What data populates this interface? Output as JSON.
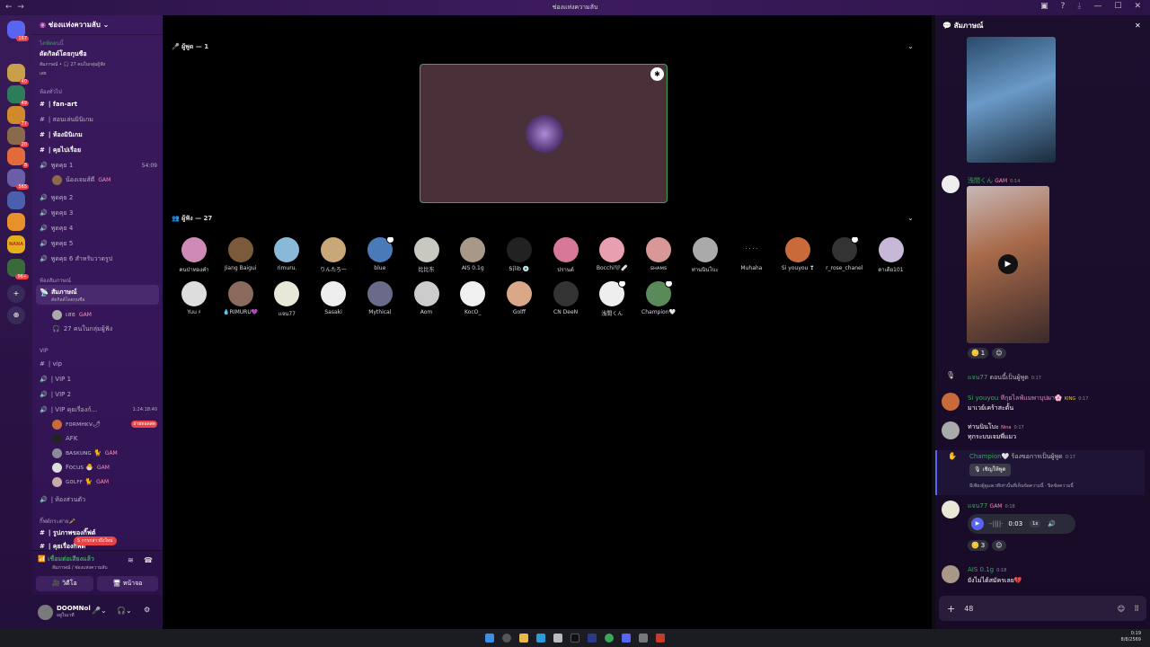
{
  "window": {
    "title": "ช่องแห่งความลับ",
    "back": "←",
    "forward": "→"
  },
  "servers": [
    {
      "badge": "167",
      "color": "#5865f2"
    },
    {
      "badge": "40",
      "color": "#c9a04a"
    },
    {
      "badge": "49",
      "color": "#2e7d5a"
    },
    {
      "badge": "77",
      "color": "#d08a2a"
    },
    {
      "badge": "20",
      "color": "#8a6a4a"
    },
    {
      "badge": "8",
      "color": "#e36a3a"
    },
    {
      "badge": "565",
      "color": "#6a5ea8"
    },
    {
      "badge": "",
      "color": "#4a5fae"
    },
    {
      "badge": "",
      "color": "#e8912a"
    },
    {
      "badge": "",
      "color": "#e4b01a",
      "text": "NANA"
    },
    {
      "badge": "96+",
      "color": "#3a6a3a"
    }
  ],
  "sidebar": {
    "server_name": "ช่องแห่งความลับ",
    "event": {
      "label": "ไลฟ์ตอนนี้",
      "title": "ดัดกิลด์โดยกุนซือ",
      "host": "สัมภาษณ์ • 🎧 27 คนในกลุ่มผู้ฟัง",
      "host2": "เสธ"
    },
    "cat1": "ห้องทั่วไป",
    "text1": [
      "| fan-art",
      "| สอนเล่นมินิเกม",
      "| ห้องมินิเกม",
      "| คุยไปเรื่อย"
    ],
    "voice_talk1": {
      "name": "พูดคุย 1",
      "timer": "54:09",
      "member": "น้องเจมส์ดี"
    },
    "voice_rooms": [
      "พูดคุย 2",
      "พูดคุย 3",
      "พูดคุย 4",
      "พูดคุย 5",
      "พูดคุย 6 สำหรับวาดรูป"
    ],
    "cat2": "ห้องสัมภาษณ์",
    "stage": {
      "name": "สัมภาษณ์",
      "sub": "ดัดกิลด์โดยกุนซือ",
      "speaker": "เสธ",
      "listeners": "27 คนในกลุ่มผู้ฟัง"
    },
    "cat3": "VIP",
    "vip": [
      "| vip",
      "| VIP 1",
      "| VIP 2"
    ],
    "vip_talk": {
      "name": "| VIP คุยเรื่องก์...",
      "timer": "1:24:18:40",
      "members": [
        "ꜰᴏʀᴍʜᴋᴠ🌶",
        "AFK",
        "ʙᴀꜱᴋᴜɴɢ 🐈",
        "Focus 🐣",
        "ɢᴏʟꜰꜰ 🐈"
      ],
      "live": "ถ่ายทอดสด"
    },
    "private": "| ห้องส่วนตัว",
    "cat4": "กิ๊ฟต์กระต่าย🥕",
    "last": "| รูปภาพของกิ๊ฟต์",
    "last2": "| คุยเรื่องกิ๊ฟต์",
    "new_msg": "5 การกล่าวถึงใหม่"
  },
  "voice_status": {
    "title": "เชื่อมต่อเสียงแล้ว",
    "sub": "สัมภาษณ์ / ช่องแห่งความลับ",
    "video": "วิดีโอ",
    "screen": "หน้าจอ"
  },
  "user": {
    "name": "DOOMNol",
    "status": "อยู่ในเวที"
  },
  "stage_main": {
    "speakers_label": "ผู้พูด — 1",
    "audience_label": "ผู้ฟัง — 27",
    "audience": [
      {
        "name": "คนป่าทองคำ",
        "color": "#d08ab8"
      },
      {
        "name": "Jiang Baigui",
        "color": "#7a5a3a"
      },
      {
        "name": "rimuru.",
        "color": "#8ab8d8"
      },
      {
        "name": "りんたろー",
        "color": "#c8a878"
      },
      {
        "name": "blue",
        "color": "#4a7ab8",
        "st": true
      },
      {
        "name": "比比东",
        "color": "#c8c8c0"
      },
      {
        "name": "AIS 0.1g",
        "color": "#a89888"
      },
      {
        "name": "Ꭶ꩝ꨮlib 💿",
        "color": "#222"
      },
      {
        "name": "ปรานต์",
        "color": "#d87898"
      },
      {
        "name": "Bocchi🖤🩹",
        "color": "#e8a0b0"
      },
      {
        "name": "ꜱʜᴀᴍꜱ",
        "color": "#d89898"
      },
      {
        "name": "ท่านนินโบะ",
        "color": "#aaa"
      },
      {
        "name": "Muhaha",
        "color": "#000",
        "dots": true
      },
      {
        "name": "Si youyou ❣",
        "color": "#c86a3a"
      },
      {
        "name": "r_rose_chanel",
        "color": "#333",
        "st": true
      },
      {
        "name": "ดาเดีย101",
        "color": "#c8b8d8"
      },
      {
        "name": "Yuu ♯",
        "color": "#ddd"
      },
      {
        "name": "💧RIMURU💜",
        "color": "#8a6a5a"
      },
      {
        "name": "แจน77",
        "color": "#e8e8d8"
      },
      {
        "name": "Sasaki",
        "color": "#eee"
      },
      {
        "name": "Mythical",
        "color": "#6a6a8a"
      },
      {
        "name": "Aom",
        "color": "#ccc"
      },
      {
        "name": "KocO_",
        "color": "#f0f0f0"
      },
      {
        "name": "Golff",
        "color": "#d8a888"
      },
      {
        "name": "CN DeeN",
        "color": "#333"
      },
      {
        "name": "浅間くん",
        "color": "#eee",
        "st": true
      },
      {
        "name": "Champion🤍",
        "color": "#5a8a5a",
        "st": true
      }
    ]
  },
  "chat": {
    "title": "สัมภาษณ์",
    "m1": {
      "name": "浅間くん",
      "tag": "GAM",
      "time": "0:14"
    },
    "m1_react": "1",
    "m2": {
      "name": "แจน77",
      "text": "ตอนนี้เป็นผู้พูด",
      "time": "0:17"
    },
    "m3": {
      "name": "Si youyou",
      "sub": "ทีกุยไลฟ์แมพาบุปผา🌸",
      "tag": "KING",
      "time": "0:17",
      "text": "มาเวย์เคร้าสะดั้น"
    },
    "m4": {
      "name": "ท่านนินโบะ",
      "tag": "Nina",
      "time": "0:17",
      "text": "ทุกระบบเจมพี่แมว"
    },
    "m5": {
      "name": "Champion🤍",
      "text": "ร้องขอการเป็นผู้พูด",
      "time": "0:17",
      "btn": "เชิญให้พูด",
      "note": "มีเพียงผู้ดูแลเวทีเท่านั้นที่เห็นข้อความนี้ · ปิดข้อความนี้"
    },
    "m6": {
      "name": "แจน77",
      "tag": "GAM",
      "time": "0:18",
      "audio_time": "0:03",
      "speed": "1x",
      "react": "3"
    },
    "m7": {
      "name": "AIS 0.1g",
      "time": "0:18",
      "text": "ยังไม่ได้สมัครเลย💔"
    },
    "input": "48"
  },
  "clock": {
    "time": "0:19",
    "date": "8/8/2569"
  }
}
